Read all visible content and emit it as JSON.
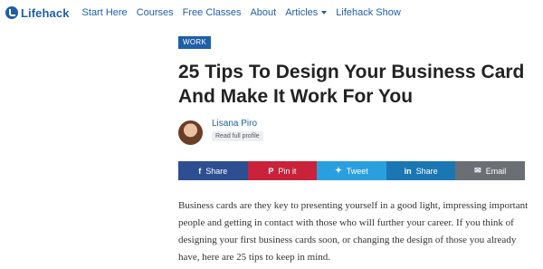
{
  "nav": {
    "logo_text": "Lifehack",
    "links": [
      {
        "label": "Start Here"
      },
      {
        "label": "Courses"
      },
      {
        "label": "Free Classes"
      },
      {
        "label": "About"
      },
      {
        "label": "Articles"
      },
      {
        "label": "Lifehack Show"
      }
    ]
  },
  "article": {
    "category": "WORK",
    "title": "25 Tips To Design Your Business Card And Make It Work For You",
    "author": {
      "name": "Lisana Piro",
      "profile_link": "Read full profile"
    },
    "body": "Business cards are they key to presenting yourself in a good light, impressing important people and getting in contact with those who will further your career. If you think of designing your first business cards soon, or changing the design of those you already have, here are 25 tips to keep in mind."
  },
  "share": {
    "facebook": {
      "label": "Share",
      "icon": "facebook-icon",
      "color": "#2d4e90"
    },
    "pinterest": {
      "label": "Pin it",
      "icon": "pinterest-icon",
      "color": "#c8233a"
    },
    "twitter": {
      "label": "Tweet",
      "icon": "twitter-icon",
      "color": "#2a9fe0"
    },
    "linkedin": {
      "label": "Share",
      "icon": "linkedin-icon",
      "color": "#1b77b4"
    },
    "email": {
      "label": "Email",
      "icon": "email-icon",
      "color": "#6a6f75"
    }
  },
  "colors": {
    "brand": "#1f5fa6"
  }
}
